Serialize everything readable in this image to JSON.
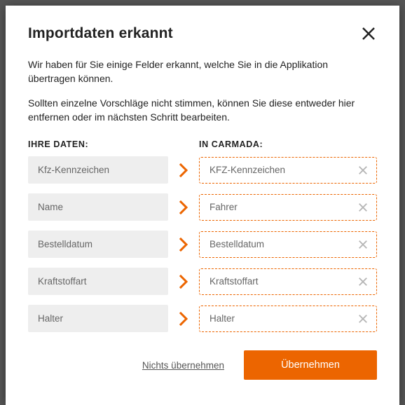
{
  "modal": {
    "title": "Importdaten erkannt",
    "intro1": "Wir haben für Sie einige Felder erkannt, welche Sie in die Applikation übertragen können.",
    "intro2": "Sollten einzelne Vorschläge nicht stimmen, können Sie diese entweder hier entfernen oder im nächsten Schritt bearbeiten.",
    "source_header": "IHRE DATEN:",
    "target_header": "IN CARMADA:"
  },
  "mappings": [
    {
      "source": "Kfz-Kennzeichen",
      "target": "KFZ-Kennzeichen"
    },
    {
      "source": "Name",
      "target": "Fahrer"
    },
    {
      "source": "Bestelldatum",
      "target": "Bestelldatum"
    },
    {
      "source": "Kraftstoffart",
      "target": "Kraftstoffart"
    },
    {
      "source": "Halter",
      "target": "Halter"
    }
  ],
  "footer": {
    "skip": "Nichts übernehmen",
    "accept": "Übernehmen"
  }
}
